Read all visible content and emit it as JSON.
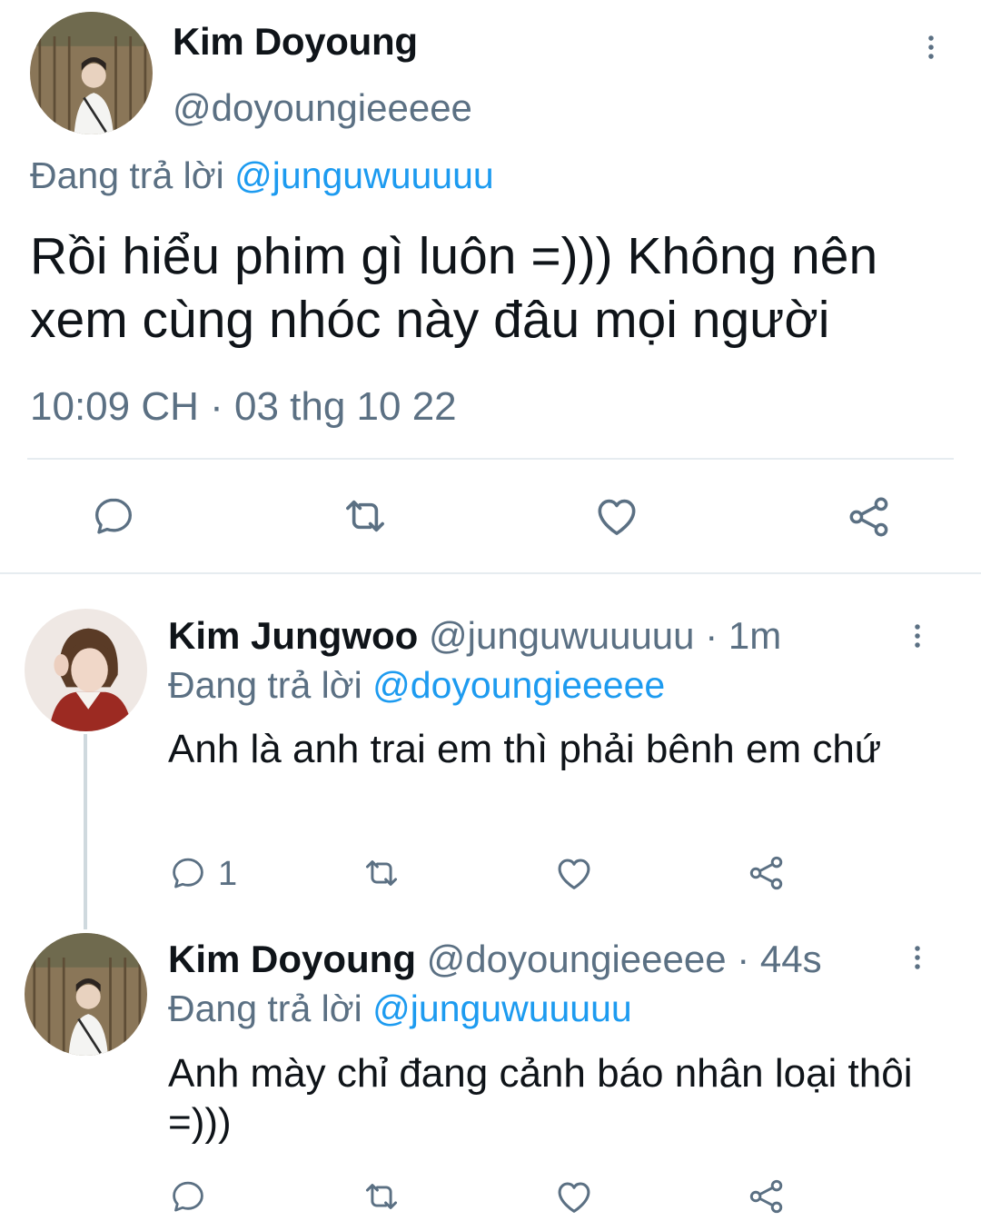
{
  "main_tweet": {
    "name": "Kim Doyoung",
    "handle": "@doyoungieeeee",
    "replying_prefix": "Đang trả lời",
    "replying_to": "@junguwuuuuu",
    "text": "Rồi hiểu phim gì luôn =))) Không nên xem cùng nhóc này đâu mọi người",
    "timestamp": "10:09 CH · 03 thg 10 22"
  },
  "replies": [
    {
      "name": "Kim Jungwoo",
      "handle": "@junguwuuuuu",
      "age": "· 1m",
      "replying_prefix": "Đang trả lời",
      "replying_to": "@doyoungieeeee",
      "text": "Anh là anh trai em thì phải bênh em chứ",
      "reply_count": "1"
    },
    {
      "name": "Kim Doyoung",
      "handle": "@doyoungieeeee",
      "age": "· 44s",
      "replying_prefix": "Đang trả lời",
      "replying_to": "@junguwuuuuu",
      "text": "Anh mày chỉ đang cảnh báo nhân loại thôi =)))",
      "reply_count": ""
    }
  ],
  "icons": [
    "reply-icon",
    "retweet-icon",
    "like-icon",
    "share-icon",
    "more-icon"
  ],
  "colors": {
    "link": "#1d9bf0",
    "muted": "#5b7083",
    "text": "#0f1419",
    "divider": "#e6ecf0"
  }
}
